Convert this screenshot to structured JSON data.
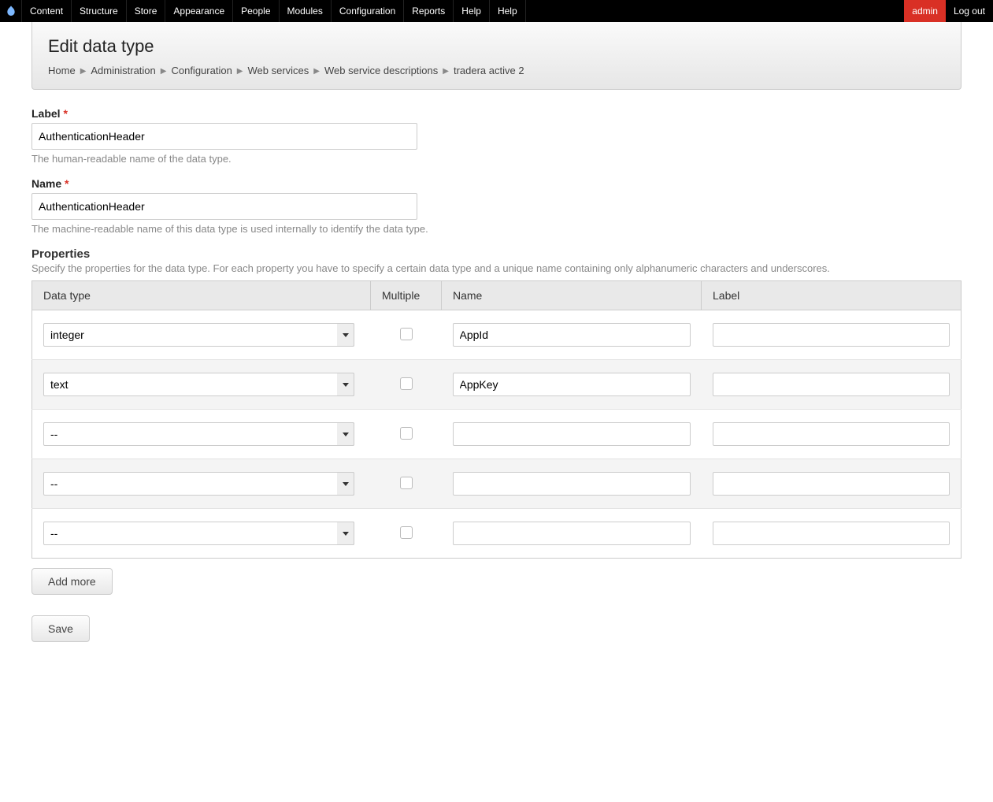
{
  "toolbar": {
    "items": [
      "Content",
      "Structure",
      "Store",
      "Appearance",
      "People",
      "Modules",
      "Configuration",
      "Reports",
      "Help",
      "Help"
    ],
    "user": "admin",
    "logout": "Log out"
  },
  "header": {
    "title": "Edit data type",
    "breadcrumb": [
      "Home",
      "Administration",
      "Configuration",
      "Web services",
      "Web service descriptions",
      "tradera active 2"
    ]
  },
  "fields": {
    "label": {
      "label": "Label",
      "value": "AuthenticationHeader",
      "desc": "The human-readable name of the data type."
    },
    "name": {
      "label": "Name",
      "value": "AuthenticationHeader",
      "desc": "The machine-readable name of this data type is used internally to identify the data type."
    }
  },
  "properties_section": {
    "title": "Properties",
    "desc": "Specify the properties for the data type. For each property you have to specify a certain data type and a unique name containing only alphanumeric characters and underscores.",
    "columns": {
      "data_type": "Data type",
      "multiple": "Multiple",
      "name": "Name",
      "label": "Label"
    },
    "rows": [
      {
        "data_type": "integer",
        "multiple": false,
        "name": "AppId",
        "label": ""
      },
      {
        "data_type": "text",
        "multiple": false,
        "name": "AppKey",
        "label": ""
      },
      {
        "data_type": "--",
        "multiple": false,
        "name": "",
        "label": ""
      },
      {
        "data_type": "--",
        "multiple": false,
        "name": "",
        "label": ""
      },
      {
        "data_type": "--",
        "multiple": false,
        "name": "",
        "label": ""
      }
    ]
  },
  "buttons": {
    "add_more": "Add more",
    "save": "Save"
  }
}
